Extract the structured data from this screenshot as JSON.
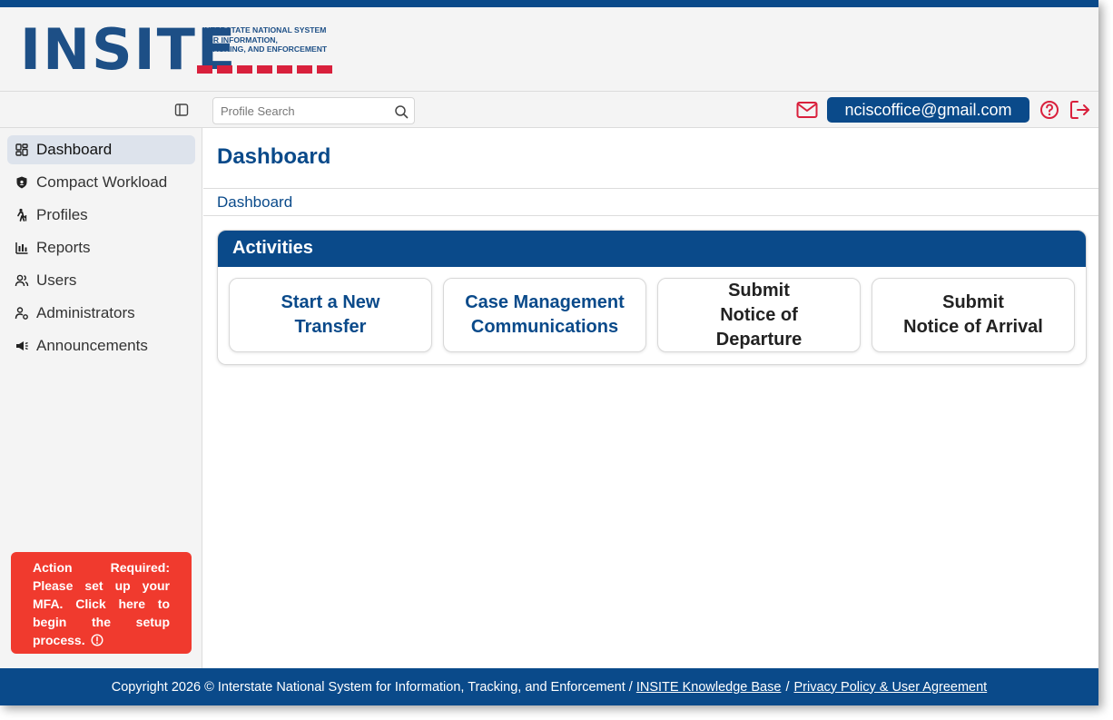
{
  "brand": {
    "logo_text": "INSITE",
    "tagline_lines": [
      "INTERSTATE NATIONAL SYSTEM",
      "FOR INFORMATION,",
      "TRACKING, AND ENFORCEMENT"
    ],
    "primary_color": "#0a4a8a",
    "accent_color": "#d9203c"
  },
  "search": {
    "placeholder": "Profile Search",
    "value": ""
  },
  "user": {
    "email": "nciscoffice@gmail.com"
  },
  "sidebar": {
    "items": [
      {
        "label": "Dashboard",
        "icon": "dashboard-grid-icon",
        "active": true
      },
      {
        "label": "Compact Workload",
        "icon": "shield-icon",
        "active": false
      },
      {
        "label": "Profiles",
        "icon": "walking-person-icon",
        "active": false
      },
      {
        "label": "Reports",
        "icon": "bar-chart-icon",
        "active": false
      },
      {
        "label": "Users",
        "icon": "users-icon",
        "active": false
      },
      {
        "label": "Administrators",
        "icon": "admin-user-icon",
        "active": false
      },
      {
        "label": "Announcements",
        "icon": "megaphone-icon",
        "active": false
      }
    ],
    "mfa_alert": "Action Required: Please set up your MFA. Click here to begin the setup process."
  },
  "main": {
    "page_title": "Dashboard",
    "breadcrumb": "Dashboard",
    "activities": {
      "title": "Activities",
      "cards": [
        {
          "label": "Start a New\nTransfer"
        },
        {
          "label": "Case Management\nCommunications"
        },
        {
          "label": "Submit\nNotice of\nDeparture"
        },
        {
          "label": "Submit\nNotice of Arrival"
        }
      ]
    }
  },
  "footer": {
    "copyright": "Copyright 2026 © Interstate National System for Information, Tracking, and Enforcement /",
    "separator": "/",
    "links": [
      "INSITE Knowledge Base",
      "Privacy Policy & User Agreement"
    ]
  }
}
